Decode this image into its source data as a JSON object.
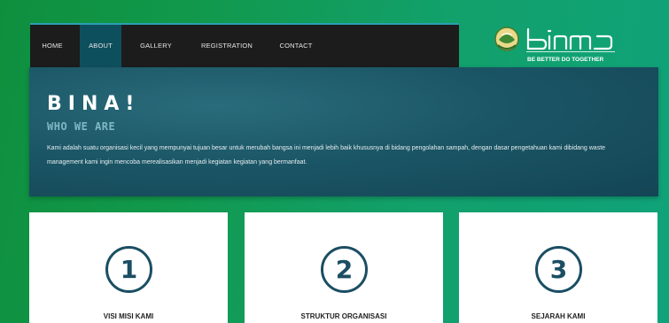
{
  "nav": {
    "items": [
      {
        "label": "HOME",
        "active": false
      },
      {
        "label": "ABOUT",
        "active": true
      },
      {
        "label": "GALLERY",
        "active": false
      },
      {
        "label": "REGISTRATION",
        "active": false
      },
      {
        "label": "CONTACT",
        "active": false
      }
    ]
  },
  "logo": {
    "text": "bina",
    "tagline": "BE BETTER DO TOGETHER",
    "icon": "leaf-globe-icon"
  },
  "hero": {
    "title": "BINA!",
    "subtitle": "WHO WE ARE",
    "description": "Kami adalah suatu organisasi kecil yang mempunyai tujuan besar untuk merubah bangsa ini menjadi lebih baik khususnya di bidang pengolahan sampah, dengan dasar pengetahuan kami dibidang waste management kami ingin mencoba merealisasikan menjadi kegiatan kegiatan yang bermanfaat."
  },
  "cards": [
    {
      "number": "1",
      "title": "VISI MISI KAMI"
    },
    {
      "number": "2",
      "title": "STRUKTUR ORGANISASI"
    },
    {
      "number": "3",
      "title": "SEJARAH KAMI"
    }
  ],
  "colors": {
    "background": "#10994f",
    "navbar": "#1c1c1c",
    "nav_active": "#0e4f5e",
    "hero": "#1b5666",
    "accent": "#1b4e63"
  }
}
